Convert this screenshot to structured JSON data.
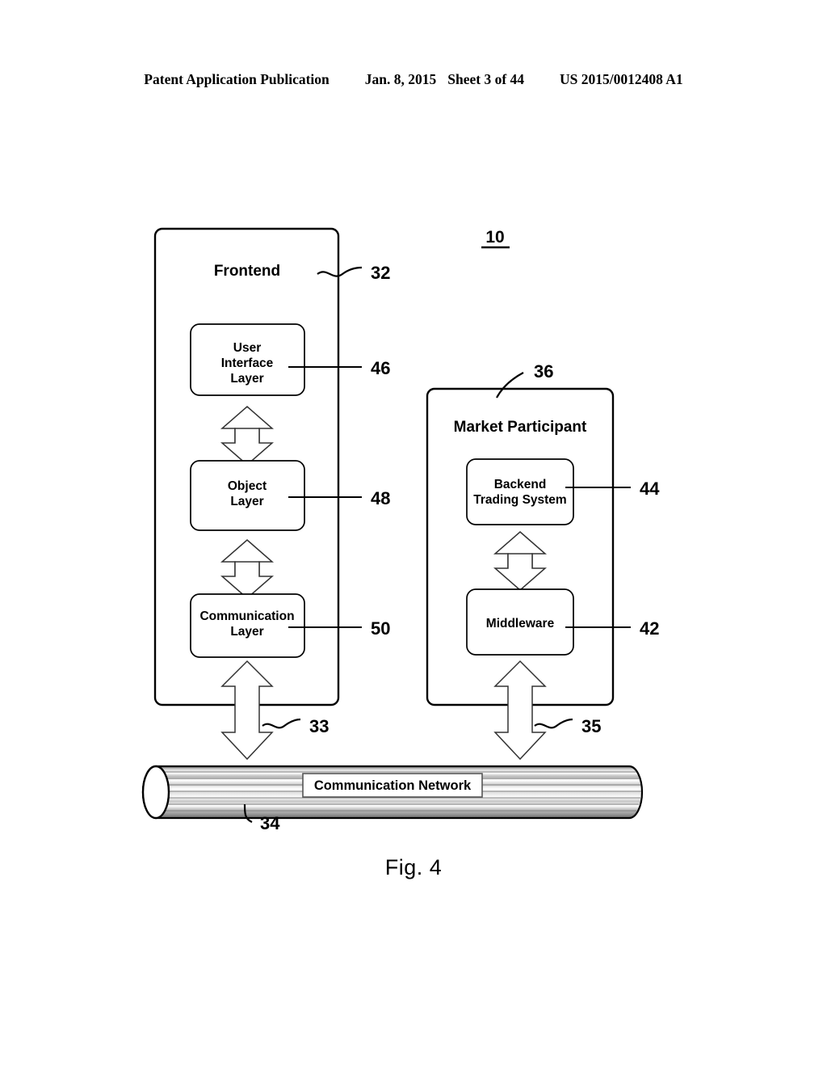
{
  "header": {
    "publication": "Patent Application Publication",
    "date": "Jan. 8, 2015",
    "sheet": "Sheet 3 of 44",
    "publication_number": "US 2015/0012408 A1"
  },
  "figure": {
    "caption": "Fig. 4",
    "system_ref": "10",
    "frontend": {
      "title": "Frontend",
      "ref": "32",
      "layers": [
        {
          "label_line1": "User",
          "label_line2": "Interface",
          "label_line3": "Layer",
          "ref": "46"
        },
        {
          "label_line1": "Object",
          "label_line2": "Layer",
          "label_line3": "",
          "ref": "48"
        },
        {
          "label_line1": "Communication",
          "label_line2": "Layer",
          "label_line3": "",
          "ref": "50"
        }
      ],
      "network_link_ref": "33"
    },
    "market_participant": {
      "title": "Market Participant",
      "ref": "36",
      "components": [
        {
          "label_line1": "Backend",
          "label_line2": "Trading System",
          "ref": "44"
        },
        {
          "label_line1": "Middleware",
          "label_line2": "",
          "ref": "42"
        }
      ],
      "network_link_ref": "35"
    },
    "network": {
      "label": "Communication Network",
      "ref": "34"
    }
  },
  "colors": {
    "ink": "#000000",
    "paper": "#ffffff",
    "arrow_outline": "#333333",
    "cylinder_shade": "#b9b9b9"
  }
}
